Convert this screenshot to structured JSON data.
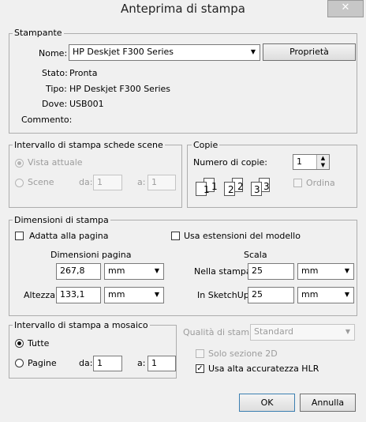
{
  "window": {
    "title": "Anteprima di stampa",
    "close_glyph": "✕"
  },
  "printer": {
    "legend": "Stampante",
    "name_label": "Nome:",
    "name_value": "HP Deskjet F300 Series",
    "properties_button": "Proprietà",
    "status_label": "Stato:",
    "status_value": "Pronta",
    "type_label": "Tipo:",
    "type_value": "HP Deskjet F300 Series",
    "where_label": "Dove:",
    "where_value": "USB001",
    "comment_label": "Commento:",
    "comment_value": ""
  },
  "range": {
    "legend": "Intervallo di stampa schede scene",
    "current_view": "Vista attuale",
    "scenes": "Scene",
    "from_label": "da:",
    "from_value": "1",
    "to_label": "a:",
    "to_value": "1"
  },
  "copies": {
    "legend": "Copie",
    "count_label": "Numero di copie:",
    "count_value": "1",
    "collate_label": "Ordina",
    "page_numbers": [
      "1",
      "1",
      "2",
      "2",
      "3",
      "3"
    ]
  },
  "dimensions": {
    "legend": "Dimensioni di stampa",
    "fit_page": "Adatta alla pagina",
    "use_model_extents": "Usa estensioni del modello",
    "page_size_heading": "Dimensioni pagina",
    "width_value": "267,8",
    "width_unit": "mm",
    "height_label": "Altezza",
    "height_value": "133,1",
    "height_unit": "mm",
    "scale_heading": "Scala",
    "in_print_label": "Nella stampa",
    "in_print_value": "25",
    "in_print_unit": "mm",
    "in_sketchup_label": "In SketchUp",
    "in_sketchup_value": "25",
    "in_sketchup_unit": "mm"
  },
  "tile": {
    "legend": "Intervallo di stampa a mosaico",
    "all": "Tutte",
    "pages": "Pagine",
    "from_label": "da:",
    "from_value": "1",
    "to_label": "a:",
    "to_value": "1"
  },
  "quality": {
    "label": "Qualità di stampa",
    "value": "Standard",
    "section_2d": "Solo sezione 2D",
    "hlr": "Usa alta accuratezza HLR",
    "hlr_checked": "✓"
  },
  "buttons": {
    "ok": "OK",
    "cancel": "Annulla"
  },
  "icons": {
    "dropdown": "▼",
    "spin_up": "▲",
    "spin_down": "▼"
  }
}
